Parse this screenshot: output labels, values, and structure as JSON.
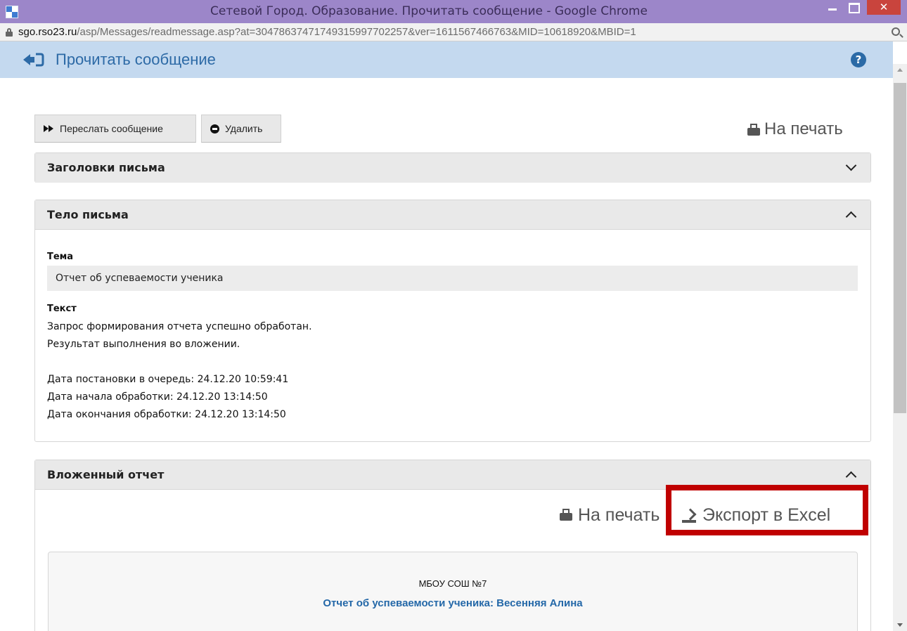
{
  "window": {
    "title": "Сетевой Город. Образование. Прочитать сообщение - Google Chrome",
    "close_glyph": "✕"
  },
  "address": {
    "host": "sgo.rso23.ru",
    "path": "/asp/Messages/readmessage.asp?at=30478637471749315997702257&ver=1611567466763&MID=10618920&MBID=1"
  },
  "header": {
    "title": "Прочитать сообщение",
    "help_glyph": "?",
    "accent_color": "#2d6aa6",
    "background_color": "#c4d9ef"
  },
  "toolbar": {
    "forward_label": "Переслать сообщение",
    "delete_label": "Удалить",
    "print_label": "На печать"
  },
  "panels": {
    "headers": {
      "title": "Заголовки письма",
      "state": "collapsed"
    },
    "body": {
      "title": "Тело письма",
      "state": "expanded",
      "subject_label": "Тема",
      "subject_value": "Отчет об успеваемости ученика",
      "text_label": "Текст",
      "text_lines": [
        "Запрос формирования отчета успешно обработан.",
        "Результат выполнения во вложении.",
        "",
        "Дата постановки в очередь: 24.12.20 10:59:41",
        "Дата начала обработки: 24.12.20 13:14:50",
        "Дата окончания обработки: 24.12.20 13:14:50"
      ]
    },
    "report": {
      "title": "Вложенный отчет",
      "state": "expanded",
      "print_label": "На печать",
      "export_label": "Экспорт в Excel",
      "highlight_color": "#c00000",
      "org_name": "МБОУ СОШ №7",
      "report_title": "Отчет об успеваемости ученика: Весенняя Алина"
    }
  },
  "icons": [
    "lock-icon",
    "zoom-icon",
    "back-icon",
    "help-icon",
    "forward-icon",
    "minus-icon",
    "printer-icon",
    "chevron-down-icon",
    "chevron-up-icon",
    "excel-export-icon"
  ]
}
